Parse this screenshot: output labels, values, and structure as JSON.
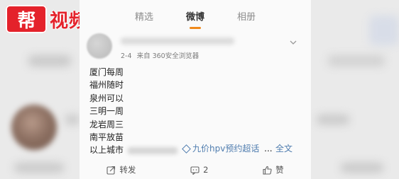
{
  "logo": {
    "box_text": "帮",
    "text": "视频"
  },
  "tabs": [
    {
      "label": "精选",
      "active": false
    },
    {
      "label": "微博",
      "active": true
    },
    {
      "label": "相册",
      "active": false
    }
  ],
  "post": {
    "date": "2-4",
    "source": "来自 360安全浏览器",
    "lines": [
      "厦门每周",
      "福州随时",
      "泉州可以",
      "三明一周",
      "龙岩周三",
      "南平放苗",
      "以上城市"
    ],
    "topic": "九价hpv预约超话",
    "ellipsis": "...",
    "full_text_link": "全文"
  },
  "actions": {
    "repost": "转发",
    "comment_count": "2",
    "like": "赞"
  },
  "colors": {
    "accent_orange": "#f08a1c",
    "link_blue": "#507daf",
    "logo_red": "#e4222b"
  }
}
